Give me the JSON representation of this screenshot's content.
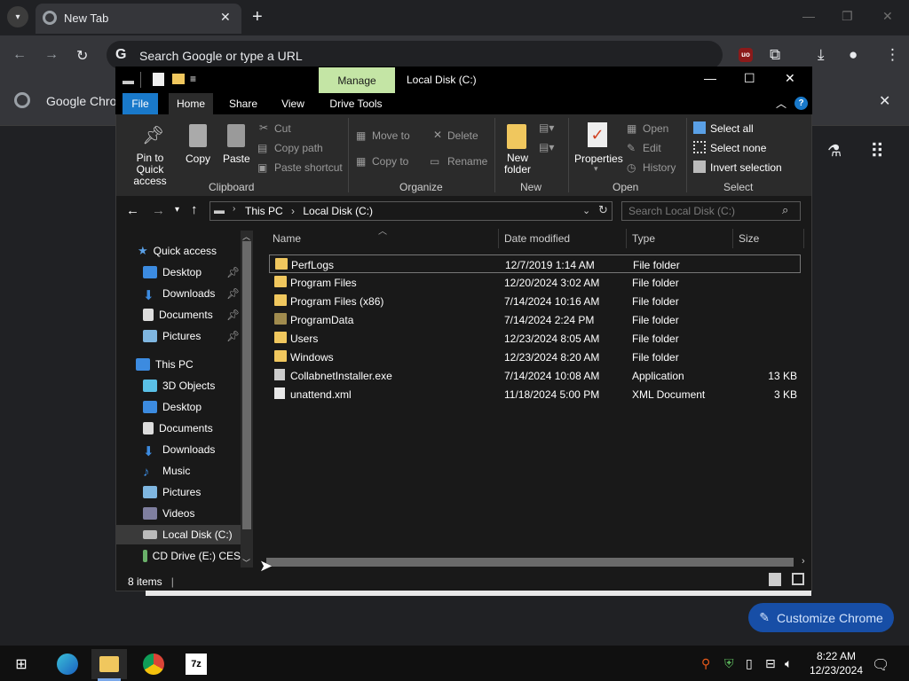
{
  "chrome": {
    "tab_title": "New Tab",
    "omnibox_placeholder": "Search Google or type a URL",
    "bookmark_label": "Google Chrom",
    "customize_label": "Customize Chrome"
  },
  "explorer": {
    "title": "Local Disk (C:)",
    "manage_label": "Manage",
    "ribbon_tabs": [
      "File",
      "Home",
      "Share",
      "View",
      "Drive Tools"
    ],
    "clipboard": {
      "pin_line1": "Pin to Quick",
      "pin_line2": "access",
      "copy": "Copy",
      "paste": "Paste",
      "cut": "Cut",
      "copy_path": "Copy path",
      "paste_shortcut": "Paste shortcut",
      "group": "Clipboard"
    },
    "organize": {
      "move_to": "Move to",
      "copy_to": "Copy to",
      "delete": "Delete",
      "rename": "Rename",
      "group": "Organize"
    },
    "new": {
      "new_folder_line1": "New",
      "new_folder_line2": "folder",
      "group": "New"
    },
    "open": {
      "properties": "Properties",
      "open": "Open",
      "edit": "Edit",
      "history": "History",
      "group": "Open"
    },
    "select": {
      "select_all": "Select all",
      "select_none": "Select none",
      "invert": "Invert selection",
      "group": "Select"
    },
    "address": {
      "this_pc": "This PC",
      "local_disk": "Local Disk (C:)"
    },
    "search_placeholder": "Search Local Disk (C:)",
    "nav": {
      "quick_access": "Quick access",
      "qa_items": [
        "Desktop",
        "Downloads",
        "Documents",
        "Pictures"
      ],
      "this_pc": "This PC",
      "pc_items": [
        "3D Objects",
        "Desktop",
        "Documents",
        "Downloads",
        "Music",
        "Pictures",
        "Videos",
        "Local Disk (C:)",
        "CD Drive (E:) CES"
      ]
    },
    "columns": {
      "name": "Name",
      "date": "Date modified",
      "type": "Type",
      "size": "Size"
    },
    "files": [
      {
        "name": "PerfLogs",
        "date": "12/7/2019 1:14 AM",
        "type": "File folder",
        "size": ""
      },
      {
        "name": "Program Files",
        "date": "12/20/2024 3:02 AM",
        "type": "File folder",
        "size": ""
      },
      {
        "name": "Program Files (x86)",
        "date": "7/14/2024 10:16 AM",
        "type": "File folder",
        "size": ""
      },
      {
        "name": "ProgramData",
        "date": "7/14/2024 2:24 PM",
        "type": "File folder",
        "size": ""
      },
      {
        "name": "Users",
        "date": "12/23/2024 8:05 AM",
        "type": "File folder",
        "size": ""
      },
      {
        "name": "Windows",
        "date": "12/23/2024 8:20 AM",
        "type": "File folder",
        "size": ""
      },
      {
        "name": "CollabnetInstaller.exe",
        "date": "7/14/2024 10:08 AM",
        "type": "Application",
        "size": "13 KB"
      },
      {
        "name": "unattend.xml",
        "date": "11/18/2024 5:00 PM",
        "type": "XML Document",
        "size": "3 KB"
      }
    ],
    "status": "8 items"
  },
  "taskbar": {
    "time": "8:22 AM",
    "date": "12/23/2024",
    "sevenzip_label": "7z"
  }
}
